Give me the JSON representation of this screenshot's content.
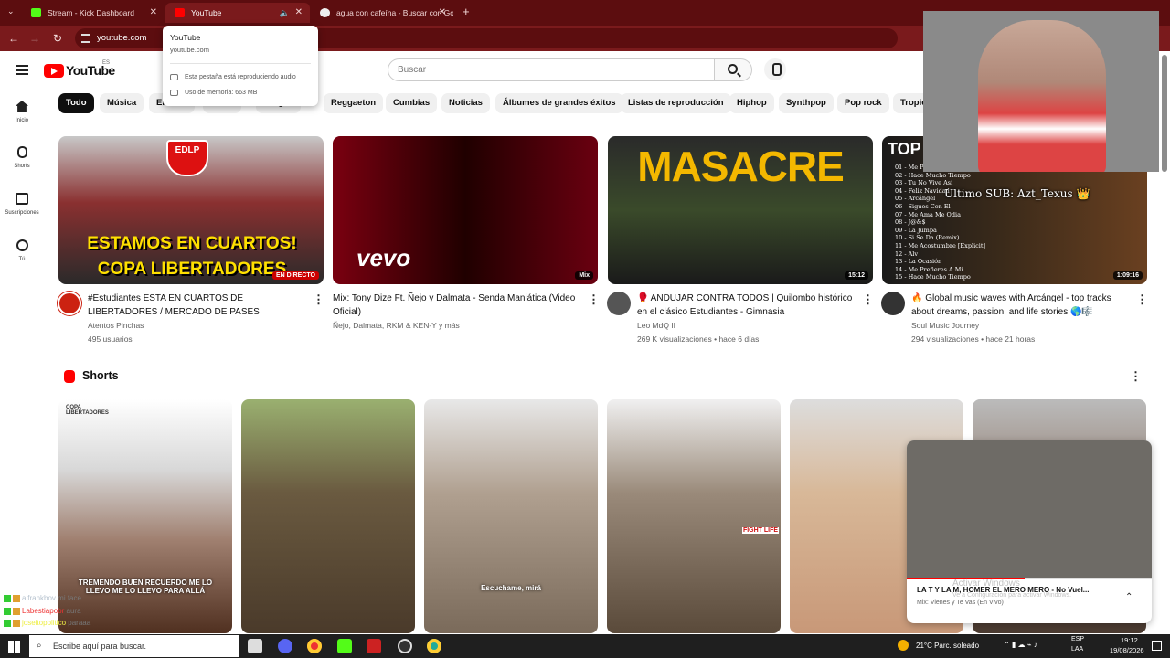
{
  "browser": {
    "tabs": [
      {
        "title": "Stream - Kick Dashboard"
      },
      {
        "title": "YouTube"
      },
      {
        "title": "agua con cafeína - Buscar con Goo"
      }
    ],
    "url": "youtube.com",
    "tooltip": {
      "title": "YouTube",
      "domain": "youtube.com",
      "audio": "Esta pestaña está reproduciendo audio",
      "memory": "Uso de memoria: 663 MB"
    }
  },
  "youtube": {
    "logo_text": "YouTube",
    "country": "ES",
    "search_placeholder": "Buscar",
    "sidebar": [
      {
        "label": "Inicio"
      },
      {
        "label": "Shorts"
      },
      {
        "label": "Suscripciones"
      },
      {
        "label": "Tú"
      }
    ],
    "chips": [
      "Todo",
      "Música",
      "En vivo",
      "Mixes",
      "Juegos",
      "Reggaeton",
      "Cumbias",
      "Noticias",
      "Álbumes de grandes éxitos",
      "Listas de reproducción",
      "Hiphop",
      "Synthpop",
      "Pop rock",
      "Tropical"
    ],
    "videos": [
      {
        "title": "#Estudiantes ESTA EN CUARTOS DE LIBERTADORES / MERCADO DE PASES",
        "channel": "Atentos Pinchas",
        "meta": "495 usuarios",
        "badge": "EN DIRECTO",
        "thumb_text": "ESTAMOS EN CUARTOS! COPA LIBERTADORES",
        "thumb_top": "EDLP"
      },
      {
        "title": "Mix: Tony Dize Ft. Ñejo y Dalmata - Senda Maniática (Video Oficial)",
        "channel": "Ñejo, Dalmata, RKM & KEN-Y y más",
        "meta": "",
        "badge": "Mix",
        "thumb_text": "vevo"
      },
      {
        "title": "🥊 ANDUJAR CONTRA TODOS | Quilombo histórico en el clásico Estudiantes - Gimnasia",
        "channel": "Leo MdQ II",
        "meta": "269 K visualizaciones • hace 6 días",
        "badge": "15:12",
        "thumb_text": "MASACRE"
      },
      {
        "title": "🔥 Global music waves with Arcángel - top tracks about dreams, passion, and life stories 🌎🎼",
        "channel": "Soul Music Journey",
        "meta": "294 visualizaciones • hace 21 horas",
        "badge": "1:09:16",
        "thumb_text": "TOP 5"
      }
    ],
    "tracklist": [
      "01 - Me Prefieres A Mí",
      "02 - Hace Mucho Tiempo",
      "03 - Tu No Vive Asi",
      "04 - Feliz Navidad",
      "05 - Arcángel",
      "06 - Sigues Con El",
      "07 - Me Ama Me Odia",
      "08 - J@&$",
      "09 - La Jumpa",
      "10 - Si Se Da (Remix)",
      "11 - Me Acostumbre [Explicit]",
      "12 - Alv",
      "13 - La Ocasión",
      "14 - Me Prefieres A Mí",
      "15 - Hace Mucho Tiempo"
    ],
    "shorts_title": "Shorts",
    "shorts": [
      {
        "caption": "TREMENDO BUEN RECUERDO ME LO LLEVO ME LO LLEVO PARA ALLÁ",
        "overlay": "COPA LIBERTADORES"
      },
      {
        "caption": ""
      },
      {
        "caption": "Escuchame, mirá"
      },
      {
        "caption": "",
        "overlay": "FIGHT LIFE"
      },
      {
        "caption": ""
      },
      {
        "caption": ""
      }
    ]
  },
  "stream_overlay": {
    "sub_message": "Ultimo SUB: Azt_Texus 👑",
    "chat": [
      {
        "user": "alfrankbov",
        "msg": "mi face"
      },
      {
        "user": "Labestiapobr",
        "msg": "aura"
      },
      {
        "user": "joseitopolitico",
        "msg": "paraaa"
      }
    ]
  },
  "miniplayer": {
    "title": "LA T Y LA M, HOMER EL MERO MERO - No Vuel...",
    "subtitle": "Mix: Vienes y Te Vas (En Vivo)"
  },
  "windows": {
    "activate_title": "Activar Windows",
    "activate_sub": "Ve a Configuración para activar Windows.",
    "taskbar_search": "Escribe aquí para buscar.",
    "weather": "21°C  Parc. soleado",
    "lang": "ESP",
    "layout": "LAA",
    "time": "19:12",
    "date": "19/08/2026"
  },
  "colors": {
    "browser_frame": "#5c0d0f",
    "yt_red": "#ff0000",
    "chip_active": "#0f0f0f"
  }
}
